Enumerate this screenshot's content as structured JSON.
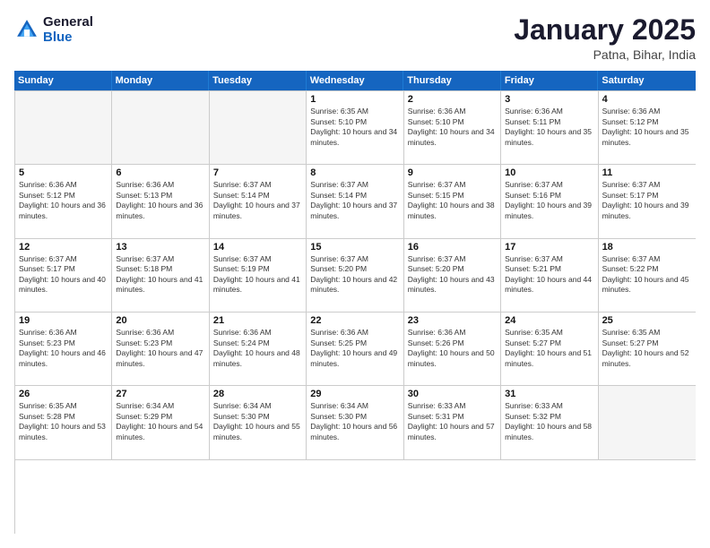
{
  "header": {
    "logo_line1": "General",
    "logo_line2": "Blue",
    "month_title": "January 2025",
    "location": "Patna, Bihar, India"
  },
  "weekdays": [
    "Sunday",
    "Monday",
    "Tuesday",
    "Wednesday",
    "Thursday",
    "Friday",
    "Saturday"
  ],
  "weeks": [
    [
      {
        "day": "",
        "sunrise": "",
        "sunset": "",
        "daylight": ""
      },
      {
        "day": "",
        "sunrise": "",
        "sunset": "",
        "daylight": ""
      },
      {
        "day": "",
        "sunrise": "",
        "sunset": "",
        "daylight": ""
      },
      {
        "day": "1",
        "sunrise": "Sunrise: 6:35 AM",
        "sunset": "Sunset: 5:10 PM",
        "daylight": "Daylight: 10 hours and 34 minutes."
      },
      {
        "day": "2",
        "sunrise": "Sunrise: 6:36 AM",
        "sunset": "Sunset: 5:10 PM",
        "daylight": "Daylight: 10 hours and 34 minutes."
      },
      {
        "day": "3",
        "sunrise": "Sunrise: 6:36 AM",
        "sunset": "Sunset: 5:11 PM",
        "daylight": "Daylight: 10 hours and 35 minutes."
      },
      {
        "day": "4",
        "sunrise": "Sunrise: 6:36 AM",
        "sunset": "Sunset: 5:12 PM",
        "daylight": "Daylight: 10 hours and 35 minutes."
      }
    ],
    [
      {
        "day": "5",
        "sunrise": "Sunrise: 6:36 AM",
        "sunset": "Sunset: 5:12 PM",
        "daylight": "Daylight: 10 hours and 36 minutes."
      },
      {
        "day": "6",
        "sunrise": "Sunrise: 6:36 AM",
        "sunset": "Sunset: 5:13 PM",
        "daylight": "Daylight: 10 hours and 36 minutes."
      },
      {
        "day": "7",
        "sunrise": "Sunrise: 6:37 AM",
        "sunset": "Sunset: 5:14 PM",
        "daylight": "Daylight: 10 hours and 37 minutes."
      },
      {
        "day": "8",
        "sunrise": "Sunrise: 6:37 AM",
        "sunset": "Sunset: 5:14 PM",
        "daylight": "Daylight: 10 hours and 37 minutes."
      },
      {
        "day": "9",
        "sunrise": "Sunrise: 6:37 AM",
        "sunset": "Sunset: 5:15 PM",
        "daylight": "Daylight: 10 hours and 38 minutes."
      },
      {
        "day": "10",
        "sunrise": "Sunrise: 6:37 AM",
        "sunset": "Sunset: 5:16 PM",
        "daylight": "Daylight: 10 hours and 39 minutes."
      },
      {
        "day": "11",
        "sunrise": "Sunrise: 6:37 AM",
        "sunset": "Sunset: 5:17 PM",
        "daylight": "Daylight: 10 hours and 39 minutes."
      }
    ],
    [
      {
        "day": "12",
        "sunrise": "Sunrise: 6:37 AM",
        "sunset": "Sunset: 5:17 PM",
        "daylight": "Daylight: 10 hours and 40 minutes."
      },
      {
        "day": "13",
        "sunrise": "Sunrise: 6:37 AM",
        "sunset": "Sunset: 5:18 PM",
        "daylight": "Daylight: 10 hours and 41 minutes."
      },
      {
        "day": "14",
        "sunrise": "Sunrise: 6:37 AM",
        "sunset": "Sunset: 5:19 PM",
        "daylight": "Daylight: 10 hours and 41 minutes."
      },
      {
        "day": "15",
        "sunrise": "Sunrise: 6:37 AM",
        "sunset": "Sunset: 5:20 PM",
        "daylight": "Daylight: 10 hours and 42 minutes."
      },
      {
        "day": "16",
        "sunrise": "Sunrise: 6:37 AM",
        "sunset": "Sunset: 5:20 PM",
        "daylight": "Daylight: 10 hours and 43 minutes."
      },
      {
        "day": "17",
        "sunrise": "Sunrise: 6:37 AM",
        "sunset": "Sunset: 5:21 PM",
        "daylight": "Daylight: 10 hours and 44 minutes."
      },
      {
        "day": "18",
        "sunrise": "Sunrise: 6:37 AM",
        "sunset": "Sunset: 5:22 PM",
        "daylight": "Daylight: 10 hours and 45 minutes."
      }
    ],
    [
      {
        "day": "19",
        "sunrise": "Sunrise: 6:36 AM",
        "sunset": "Sunset: 5:23 PM",
        "daylight": "Daylight: 10 hours and 46 minutes."
      },
      {
        "day": "20",
        "sunrise": "Sunrise: 6:36 AM",
        "sunset": "Sunset: 5:23 PM",
        "daylight": "Daylight: 10 hours and 47 minutes."
      },
      {
        "day": "21",
        "sunrise": "Sunrise: 6:36 AM",
        "sunset": "Sunset: 5:24 PM",
        "daylight": "Daylight: 10 hours and 48 minutes."
      },
      {
        "day": "22",
        "sunrise": "Sunrise: 6:36 AM",
        "sunset": "Sunset: 5:25 PM",
        "daylight": "Daylight: 10 hours and 49 minutes."
      },
      {
        "day": "23",
        "sunrise": "Sunrise: 6:36 AM",
        "sunset": "Sunset: 5:26 PM",
        "daylight": "Daylight: 10 hours and 50 minutes."
      },
      {
        "day": "24",
        "sunrise": "Sunrise: 6:35 AM",
        "sunset": "Sunset: 5:27 PM",
        "daylight": "Daylight: 10 hours and 51 minutes."
      },
      {
        "day": "25",
        "sunrise": "Sunrise: 6:35 AM",
        "sunset": "Sunset: 5:27 PM",
        "daylight": "Daylight: 10 hours and 52 minutes."
      }
    ],
    [
      {
        "day": "26",
        "sunrise": "Sunrise: 6:35 AM",
        "sunset": "Sunset: 5:28 PM",
        "daylight": "Daylight: 10 hours and 53 minutes."
      },
      {
        "day": "27",
        "sunrise": "Sunrise: 6:34 AM",
        "sunset": "Sunset: 5:29 PM",
        "daylight": "Daylight: 10 hours and 54 minutes."
      },
      {
        "day": "28",
        "sunrise": "Sunrise: 6:34 AM",
        "sunset": "Sunset: 5:30 PM",
        "daylight": "Daylight: 10 hours and 55 minutes."
      },
      {
        "day": "29",
        "sunrise": "Sunrise: 6:34 AM",
        "sunset": "Sunset: 5:30 PM",
        "daylight": "Daylight: 10 hours and 56 minutes."
      },
      {
        "day": "30",
        "sunrise": "Sunrise: 6:33 AM",
        "sunset": "Sunset: 5:31 PM",
        "daylight": "Daylight: 10 hours and 57 minutes."
      },
      {
        "day": "31",
        "sunrise": "Sunrise: 6:33 AM",
        "sunset": "Sunset: 5:32 PM",
        "daylight": "Daylight: 10 hours and 58 minutes."
      },
      {
        "day": "",
        "sunrise": "",
        "sunset": "",
        "daylight": ""
      }
    ]
  ]
}
